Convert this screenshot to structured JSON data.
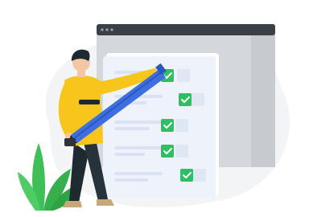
{
  "illustration": {
    "subject": "person-checking-checklist",
    "checklist_items": [
      {
        "checked": true
      },
      {
        "checked": true
      },
      {
        "checked": true
      },
      {
        "checked": true
      },
      {
        "checked": true
      }
    ],
    "colors": {
      "background_blob": "#f3f4f6",
      "window_back": "#cfd2d6",
      "window_bar": "#3a4047",
      "paper": "#eef3fb",
      "check_green": "#2fbf63",
      "pencil_blue": "#3d6fe0",
      "shirt_yellow": "#f7c51b",
      "pants_dark": "#1f2a30",
      "plant_green": "#3fbf57"
    }
  }
}
